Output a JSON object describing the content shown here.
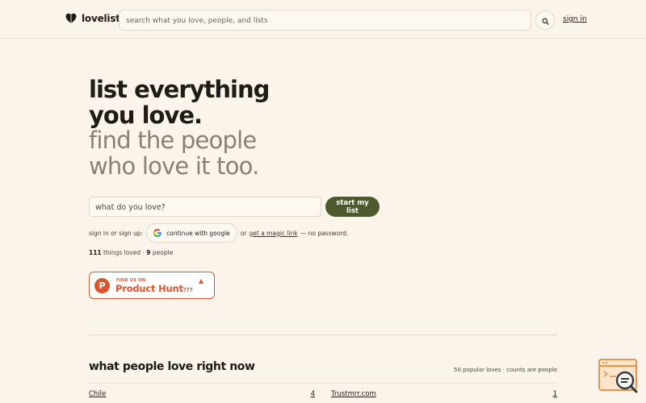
{
  "header": {
    "brand": "lovelisti",
    "search_placeholder": "search what you love, people, and lists",
    "sign_in": "sign in"
  },
  "hero": {
    "line1": "list everything",
    "line2": "you love.",
    "line3": "find the people",
    "line4": "who love it too."
  },
  "form": {
    "placeholder": "what do you love?",
    "submit_label": "start my list"
  },
  "auth": {
    "prefix": "sign in or sign up:",
    "google_label": "continue with google",
    "or_text": "or",
    "magic_link": "get a magic link",
    "suffix": "— no password."
  },
  "stats": {
    "things_count": "111",
    "things_label": "things loved ·",
    "people_count": "9",
    "people_label": "people"
  },
  "product_hunt": {
    "small": "FIND US ON",
    "big": "Product Hunt",
    "suffix": "???",
    "letter": "P"
  },
  "section": {
    "title": "what people love right now",
    "meta": "50 popular loves · counts are people",
    "items": [
      {
        "name": "Chile",
        "count": "4"
      },
      {
        "name": "Trustmrr.com",
        "count": "1"
      }
    ]
  },
  "colors": {
    "background": "#faf4ea",
    "accent": "#4d5a2e",
    "muted_text": "#8a8172",
    "product_hunt": "#da552f"
  }
}
